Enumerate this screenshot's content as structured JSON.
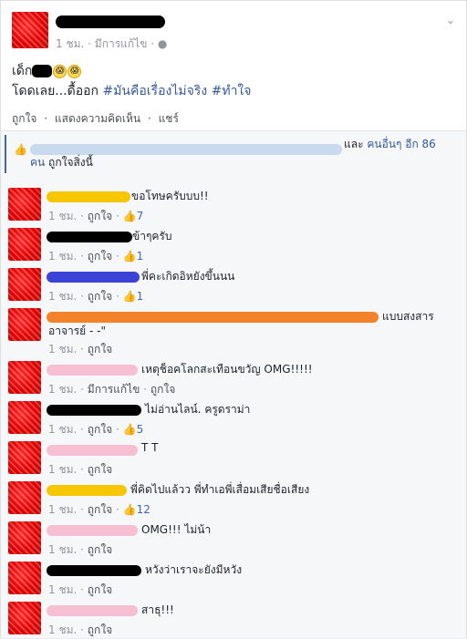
{
  "post": {
    "time": "1 ชม.",
    "edited": "มีการแก้ไข",
    "text_line1_prefix": "เด็ก",
    "emoji": [
      "😱",
      "😱"
    ],
    "text_line2_plain": "โดดเลย...ดื้ออก ",
    "hashtag1": "#มันคือเรื่องไม่จริง",
    "hashtag2": "#ทำใจ",
    "actions": {
      "like": "ถูกใจ",
      "comment": "แสดงความคิดเห็น",
      "share": "แชร์",
      "sep": "·"
    }
  },
  "likes": {
    "others_prefix": "และ ",
    "others_link": "คนอื่นๆ อีก 86",
    "line2_plain": "คน ",
    "line2_suffix": "ถูกใจสิ่งนี้"
  },
  "comments": [
    {
      "text": "ขอโทษครับบบ!!",
      "time": "1 ชม.",
      "like": "ถูกใจ",
      "count": "7",
      "edited": ""
    },
    {
      "text": "ข้าๆครับ",
      "time": "1 ชม.",
      "like": "ถูกใจ",
      "count": "1",
      "edited": ""
    },
    {
      "text": "พี่คะเกิดอิหยังขึ้นนน",
      "time": "1 ชม.",
      "like": "ถูกใจ",
      "count": "1",
      "edited": ""
    },
    {
      "text": "แบบสงสาร",
      "text2": "อาจารย์ - -\"",
      "time": "1 ชม.",
      "like": "ถูกใจ",
      "count": "",
      "edited": ""
    },
    {
      "text": "เหตุช็อคโลกสะเทือนขวัญ OMG!!!!!",
      "time": "1 ชม.",
      "like": "ถูกใจ",
      "count": "",
      "edited": "มีการแก้ไข"
    },
    {
      "text": "ไม่อ่านไลน์. ครูดราม่า",
      "time": "1 ชม.",
      "like": "ถูกใจ",
      "count": "5",
      "edited": ""
    },
    {
      "text": "T T",
      "time": "1 ชม.",
      "like": "ถูกใจ",
      "count": "",
      "edited": ""
    },
    {
      "text": "พี่คิดไปแล้วว พี่ทำเอพี่เสื่อมเสียชื่อเสียง",
      "time": "1 ชม.",
      "like": "ถูกใจ",
      "count": "12",
      "edited": ""
    },
    {
      "text": "OMG!!! ไม่น้า",
      "time": "1 ชม.",
      "like": "ถูกใจ",
      "count": "",
      "edited": ""
    },
    {
      "text": "หวังว่าเราจะยังมีหวัง",
      "time": "1 ชม.",
      "like": "ถูกใจ",
      "count": "",
      "edited": ""
    },
    {
      "text": "สาธุ!!!",
      "time": "1 ชม.",
      "like": "ถูกใจ",
      "count": "",
      "edited": ""
    }
  ],
  "icons": {
    "thumb": "thumbs-up-icon",
    "globe": "globe-icon",
    "chevron": "chevron-down-icon"
  },
  "colors": {
    "link": "#365899",
    "meta": "#90949c",
    "accent": "#4267b2"
  }
}
